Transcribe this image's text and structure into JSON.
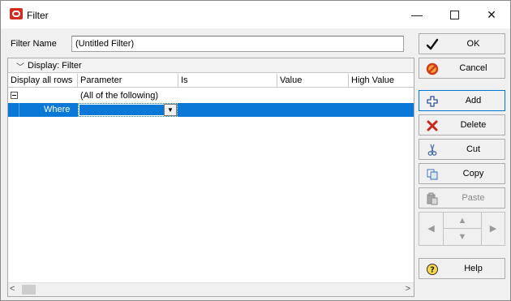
{
  "window": {
    "title": "Filter",
    "minimize_glyph": "—",
    "close_glyph": "✕"
  },
  "filter_name": {
    "label": "Filter Name",
    "value": "(Untitled Filter)"
  },
  "grid": {
    "display_label": "Display: Filter",
    "columns": [
      "Display all rows",
      "Parameter",
      "Is",
      "Value",
      "High Value"
    ],
    "rows": [
      {
        "parameter": "(All of the following)"
      },
      {
        "display": "Where",
        "parameter": ""
      }
    ]
  },
  "buttons": {
    "ok": "OK",
    "cancel": "Cancel",
    "add": "Add",
    "delete": "Delete",
    "cut": "Cut",
    "copy": "Copy",
    "paste": "Paste",
    "help": "Help"
  },
  "colors": {
    "selection": "#0a78d7",
    "app_icon": "#d22b1f",
    "focus_border": "#0078d7"
  },
  "icons": {
    "ok": "checkmark-icon",
    "cancel": "cancel-icon",
    "add": "add-icon",
    "delete": "delete-x-icon",
    "cut": "scissors-icon",
    "copy": "copy-icon",
    "paste": "paste-icon",
    "help": "help-icon"
  }
}
